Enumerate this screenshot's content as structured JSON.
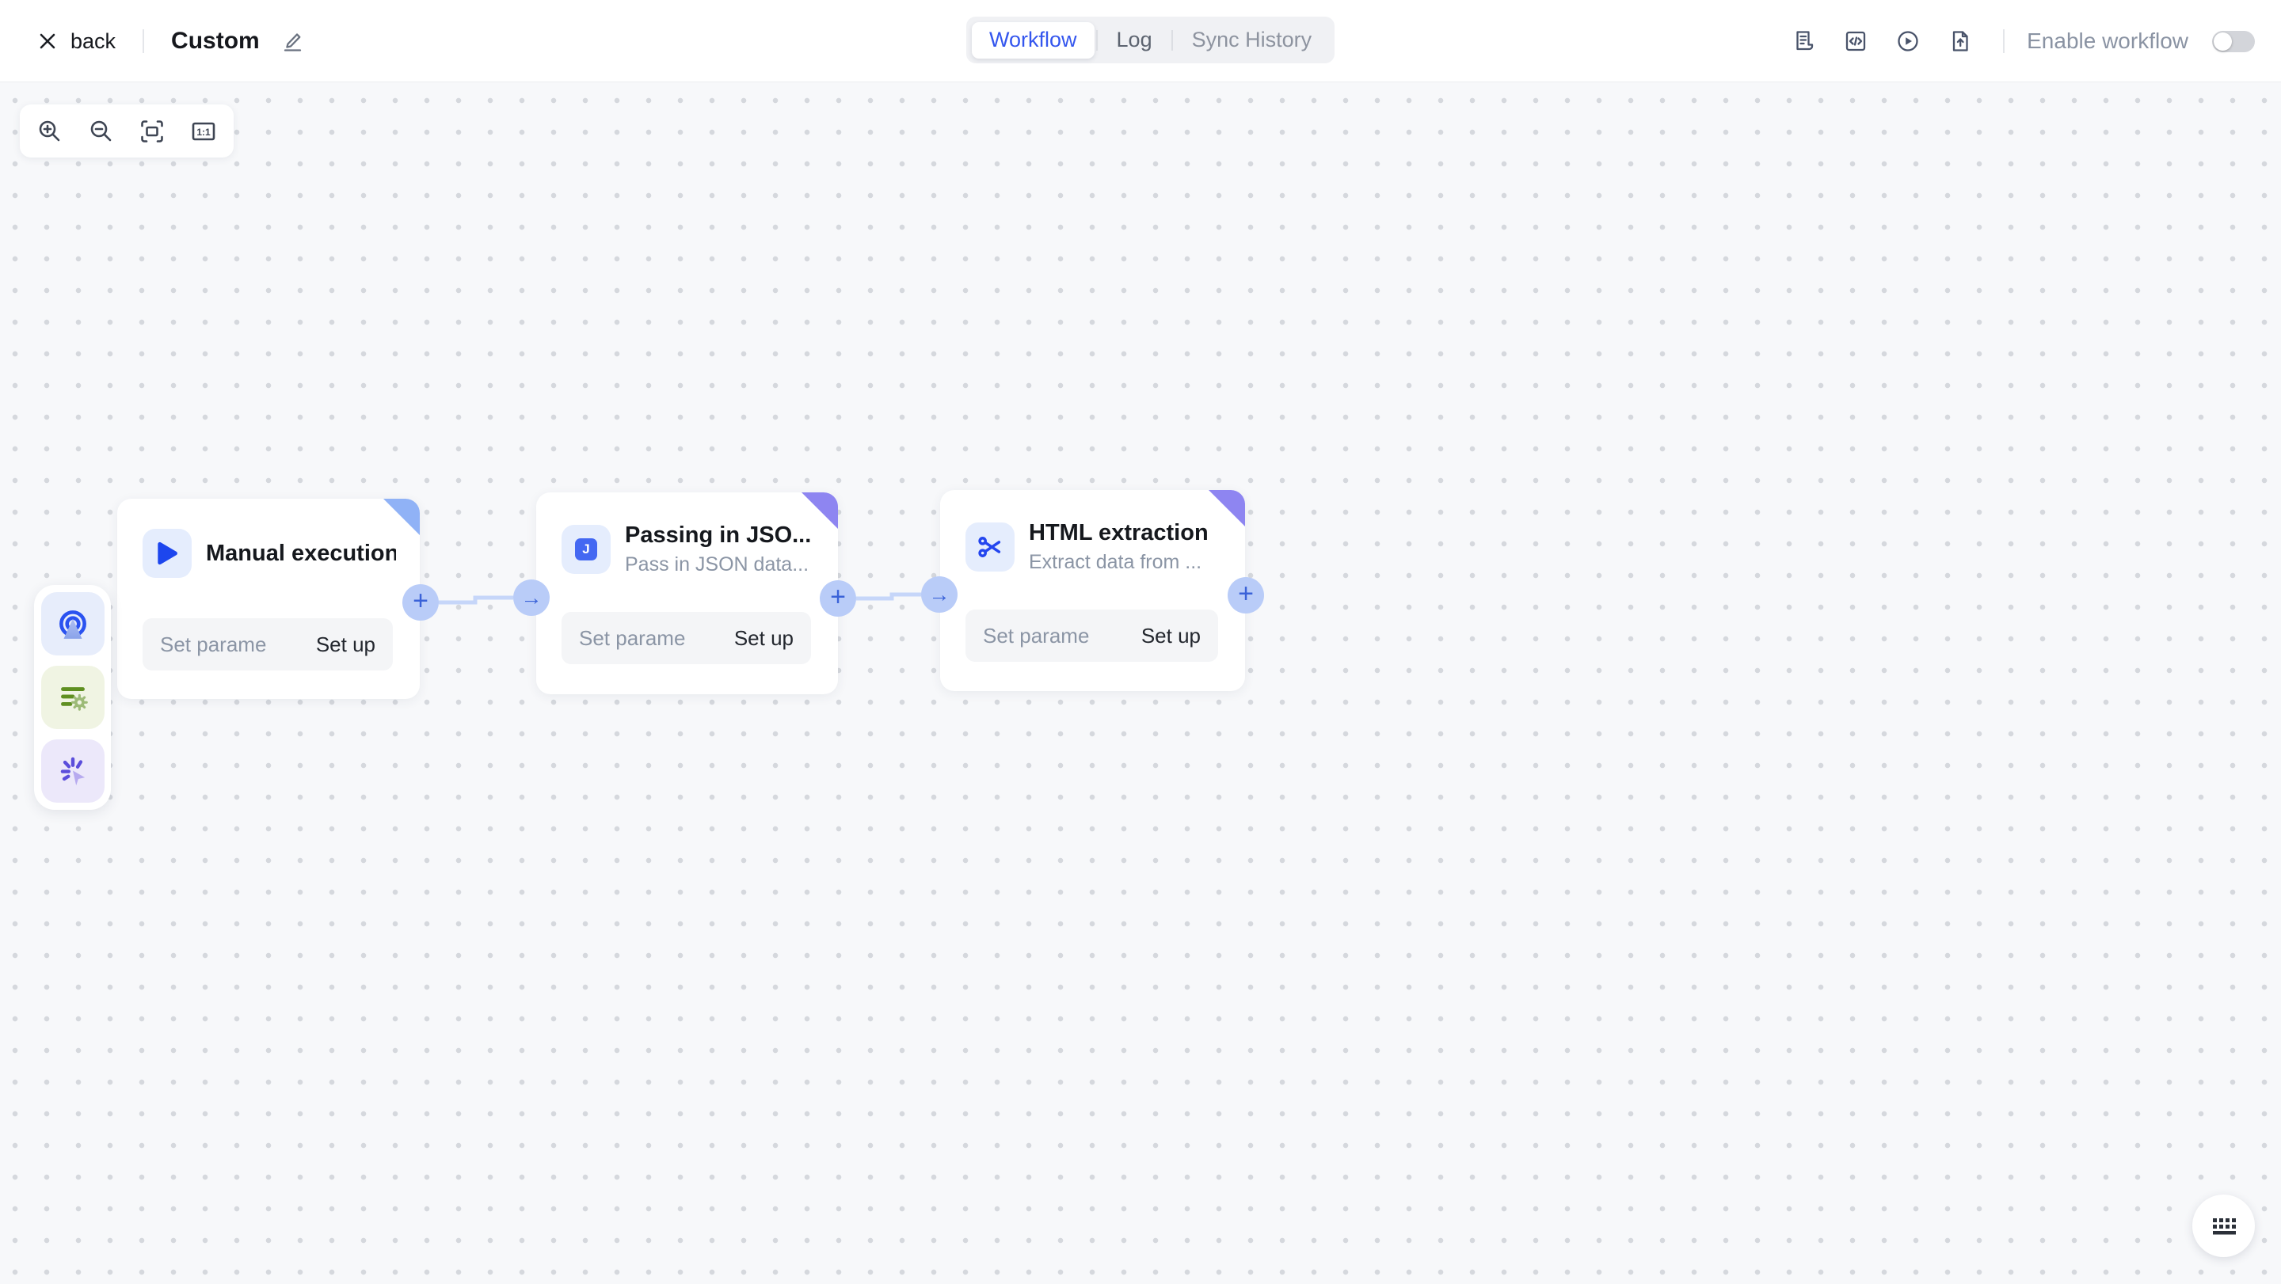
{
  "header": {
    "back_label": "back",
    "title": "Custom",
    "tabs": [
      {
        "label": "Workflow",
        "active": true
      },
      {
        "label": "Log",
        "active": false
      },
      {
        "label": "Sync History",
        "active": false
      }
    ],
    "action_icons": [
      "run-log-icon",
      "code-view-icon",
      "test-run-icon",
      "export-icon"
    ],
    "enable_label": "Enable workflow",
    "enable_workflow_on": false
  },
  "canvas": {
    "zoom_toolbar": {
      "buttons": [
        "zoom-in",
        "zoom-out",
        "fit-view",
        "actual-size"
      ],
      "actual_size_label": "1:1"
    },
    "node_palette": [
      "trigger",
      "parameter-settings",
      "manual-action"
    ],
    "nodes": [
      {
        "title": "Manual execution",
        "subtitle": "",
        "icon": "play-icon",
        "footer_left": "Set parame",
        "footer_right": "Set up",
        "out_glyph": "+",
        "fold_style": "background:#90b2f6"
      },
      {
        "title": "Passing in JSO...",
        "subtitle": "Pass in JSON data...",
        "icon": "json-icon",
        "icon_letter": "J",
        "footer_left": "Set parame",
        "footer_right": "Set up",
        "in_glyph": "→",
        "out_glyph": "+",
        "fold_style": "background:#8e85f1"
      },
      {
        "title": "HTML extraction",
        "subtitle": "Extract data from ...",
        "icon": "scissors-icon",
        "footer_left": "Set parame",
        "footer_right": "Set up",
        "in_glyph": "→",
        "out_glyph": "+",
        "fold_style": "background:#8e85f1"
      }
    ],
    "keyboard_shortcut_button": "keyboard-icon"
  },
  "colors": {
    "accent_blue": "#3456ee",
    "icon_blue": "#2a52f0",
    "port_bg": "#b9ccf8",
    "port_glyph": "#3a62d8",
    "connector": "#c6d6f9",
    "fold_blue": "#90b2f6",
    "fold_purple": "#8e85f1",
    "canvas_bg": "#f7f8fa",
    "node_icon_bg": "#e5edfd",
    "toggle_off_track": "#d3d5da"
  }
}
